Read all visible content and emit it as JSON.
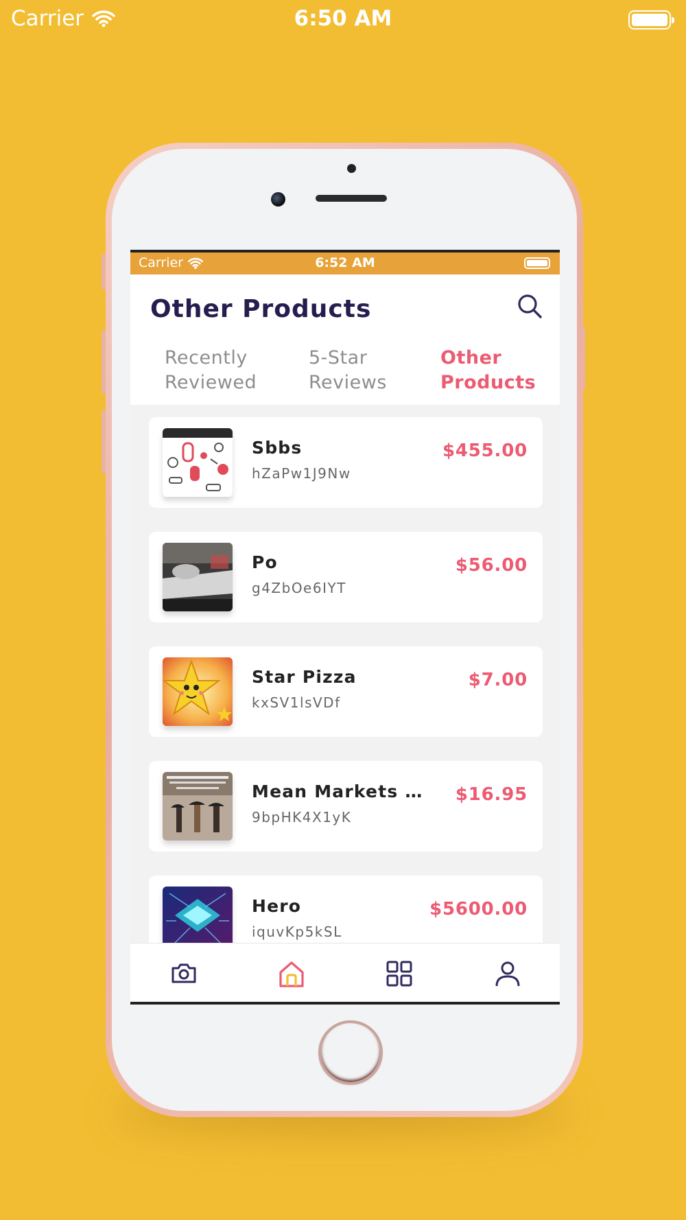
{
  "outer_status": {
    "carrier": "Carrier",
    "time": "6:50 AM"
  },
  "inner_status": {
    "carrier": "Carrier",
    "time": "6:52 AM"
  },
  "header": {
    "title": "Other Products"
  },
  "tabs": [
    {
      "label_line1": "Recently",
      "label_line2": "Reviewed",
      "active": false
    },
    {
      "label_line1": "5-Star",
      "label_line2": "Reviews",
      "active": false
    },
    {
      "label_line1": "Other",
      "label_line2": "Products",
      "active": true
    }
  ],
  "products": [
    {
      "name": "Sbbs",
      "code": "hZaPw1J9Nw",
      "price": "$455.00"
    },
    {
      "name": "Po",
      "code": "g4ZbOe6IYT",
      "price": "$56.00"
    },
    {
      "name": "Star Pizza",
      "code": "kxSV1lsVDf",
      "price": "$7.00"
    },
    {
      "name": "Mean Markets An...",
      "code": "9bpHK4X1yK",
      "price": "$16.95"
    },
    {
      "name": "Hero",
      "code": "iquvKp5kSL",
      "price": "$5600.00"
    }
  ],
  "tabbar": {
    "items": [
      "camera-icon",
      "home-icon",
      "grid-icon",
      "profile-icon"
    ],
    "active": "home-icon"
  },
  "colors": {
    "background": "#F2BD32",
    "accent": "#EC5B72",
    "title": "#241d4f",
    "inner_status": "#E7A23A"
  }
}
